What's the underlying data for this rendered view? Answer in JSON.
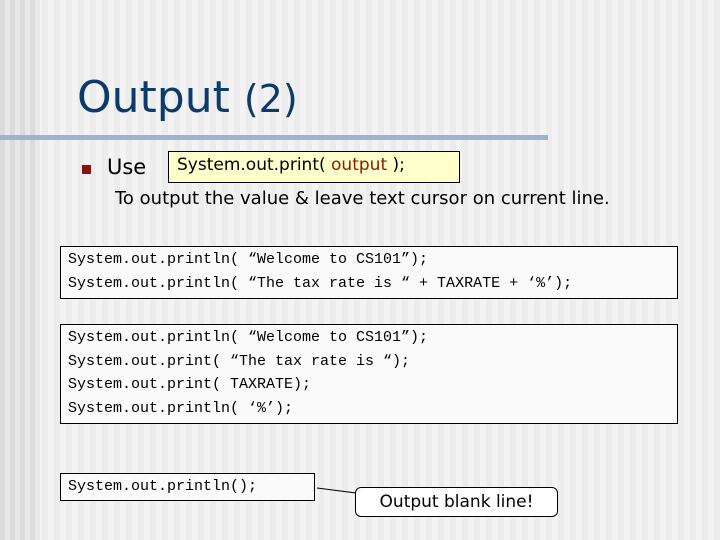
{
  "title": {
    "main": "Output",
    "num": "(2)"
  },
  "bullet": {
    "use": "Use",
    "code_prefix": "System.out.print( ",
    "code_arg": "output",
    "code_suffix": " );",
    "description": "To output the value & leave text cursor on current line."
  },
  "code_blocks": [
    [
      "System.out.println( “Welcome to CS101”);",
      "System.out.println( “The tax rate is “ + TAXRATE + ‘%’);"
    ],
    [
      "System.out.println( “Welcome to CS101”);",
      "System.out.print( “The tax rate is “);",
      "System.out.print( TAXRATE);",
      "System.out.println( ‘%’);"
    ],
    [
      "System.out.println();"
    ]
  ],
  "callout": "Output blank line!",
  "colors": {
    "title": "#0b3a6b",
    "bullet": "#8b1010",
    "highlight": "#ffffcc",
    "rule": "#9fb3cb"
  }
}
